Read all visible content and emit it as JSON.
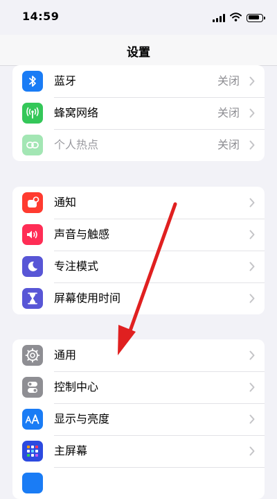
{
  "status_bar": {
    "time": "14:59"
  },
  "nav": {
    "title": "设置"
  },
  "groups": [
    {
      "items": [
        {
          "label": "蓝牙",
          "value": "关闭",
          "icon": "bluetooth-icon",
          "color": "#1a7cf5"
        },
        {
          "label": "蜂窝网络",
          "value": "关闭",
          "icon": "cellular-icon",
          "color": "#34c759"
        },
        {
          "label": "个人热点",
          "value": "关闭",
          "icon": "hotspot-icon",
          "color": "#34c759",
          "dimmed": true
        }
      ]
    },
    {
      "items": [
        {
          "label": "通知",
          "icon": "notification-icon",
          "color": "#ff3b30"
        },
        {
          "label": "声音与触感",
          "icon": "speaker-icon",
          "color": "#ff2d55"
        },
        {
          "label": "专注模式",
          "icon": "moon-icon",
          "color": "#5856d6"
        },
        {
          "label": "屏幕使用时间",
          "icon": "hourglass-icon",
          "color": "#5856d6"
        }
      ]
    },
    {
      "items": [
        {
          "label": "通用",
          "icon": "gear-icon",
          "color": "#8e8e93"
        },
        {
          "label": "控制中心",
          "icon": "toggle-icon",
          "color": "#8e8e93"
        },
        {
          "label": "显示与亮度",
          "icon": "text-size-icon",
          "color": "#1a7cf5"
        },
        {
          "label": "主屏幕",
          "icon": "home-grid-icon",
          "color": "#2c4ae0"
        }
      ]
    }
  ],
  "annotation": {
    "icon": "red-arrow-icon",
    "color": "#e02020"
  }
}
